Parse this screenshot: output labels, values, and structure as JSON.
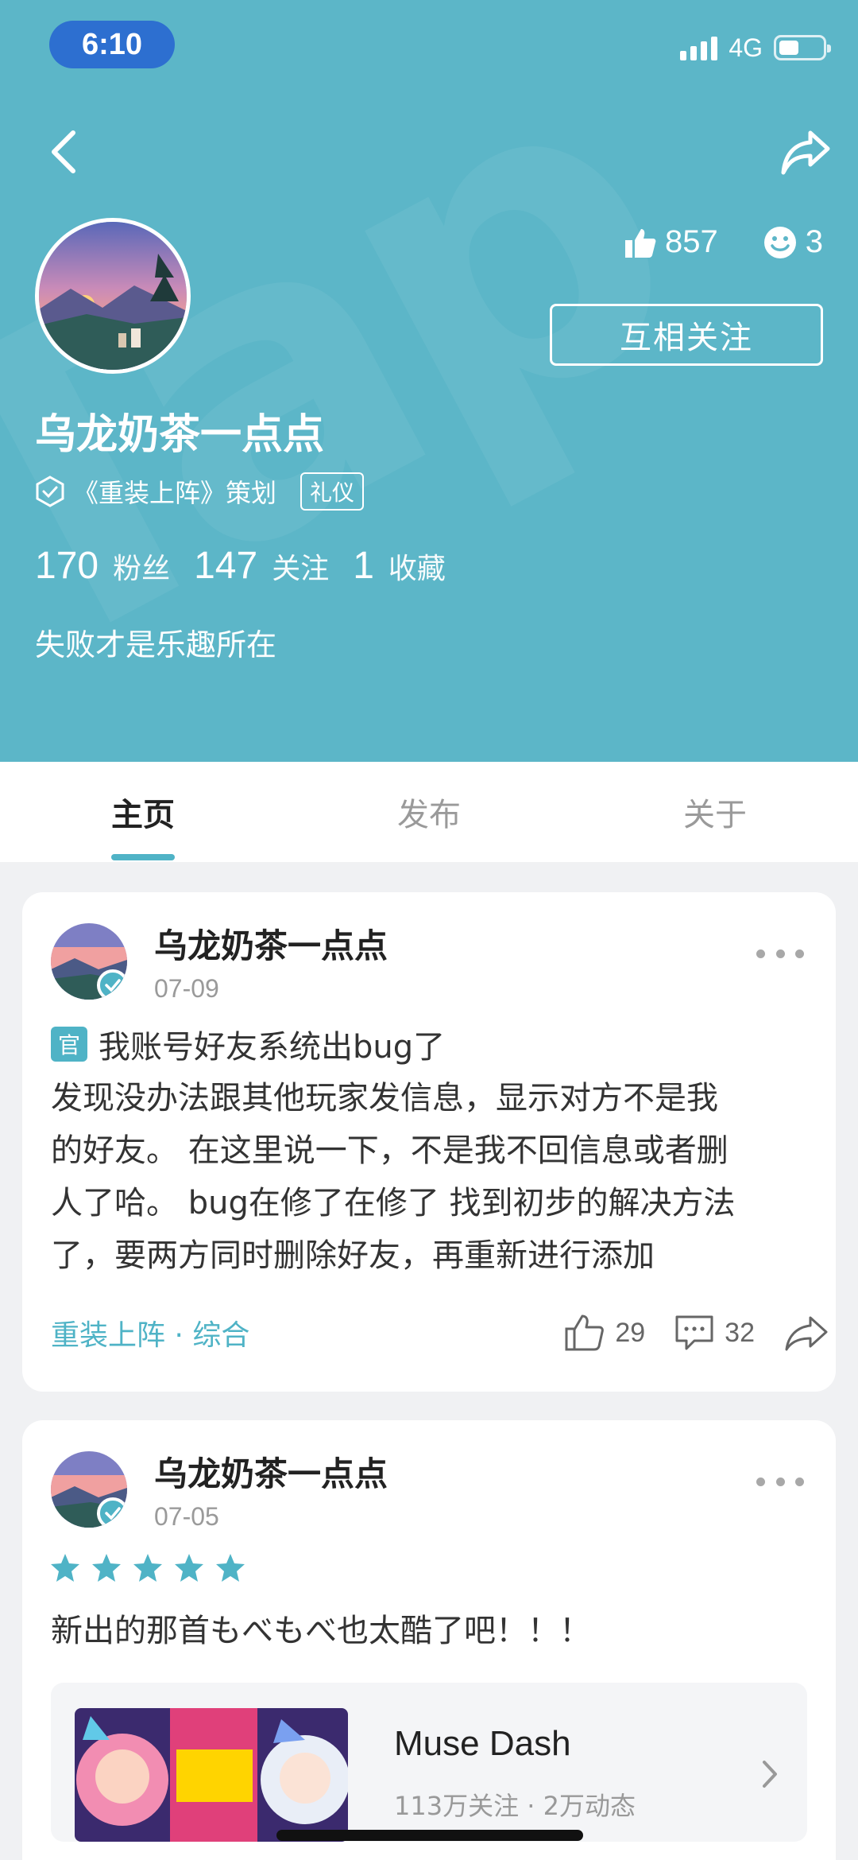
{
  "status_bar": {
    "time": "6:10",
    "network": "4G",
    "battery_fraction": 0.45
  },
  "profile": {
    "likes": "857",
    "fans_count_icon": "3",
    "follow_label": "互相关注",
    "name": "乌龙奶茶一点点",
    "role": "《重装上阵》策划",
    "role_badge": "礼仪",
    "counts": [
      {
        "num": "170",
        "label": "粉丝"
      },
      {
        "num": "147",
        "label": "关注"
      },
      {
        "num": "1",
        "label": "收藏"
      }
    ],
    "bio": "失败才是乐趣所在"
  },
  "tabs": [
    {
      "label": "主页",
      "active": true
    },
    {
      "label": "发布",
      "active": false
    },
    {
      "label": "关于",
      "active": false
    }
  ],
  "posts": [
    {
      "author": "乌龙奶茶一点点",
      "date": "07-09",
      "official_badge": "官",
      "title": "我账号好友系统出bug了",
      "body_lines": [
        "发现没办法跟其他玩家发信息，显示对方不是我",
        "的好友。 在这里说一下，不是我不回信息或者删",
        "人了哈。 bug在修了在修了  找到初步的解决方法",
        "了，要两方同时删除好友，再重新进行添加"
      ],
      "tag": "重装上阵 · 综合",
      "likes": "29",
      "comments": "32"
    },
    {
      "author": "乌龙奶茶一点点",
      "date": "07-05",
      "rating": 5,
      "text": "新出的那首もべもべ也太酷了吧！！！",
      "game": {
        "name": "Muse Dash",
        "meta": "113万关注 · 2万动态"
      }
    }
  ],
  "colors": {
    "accent": "#4fb3c6",
    "header": "#5cb6c8"
  }
}
